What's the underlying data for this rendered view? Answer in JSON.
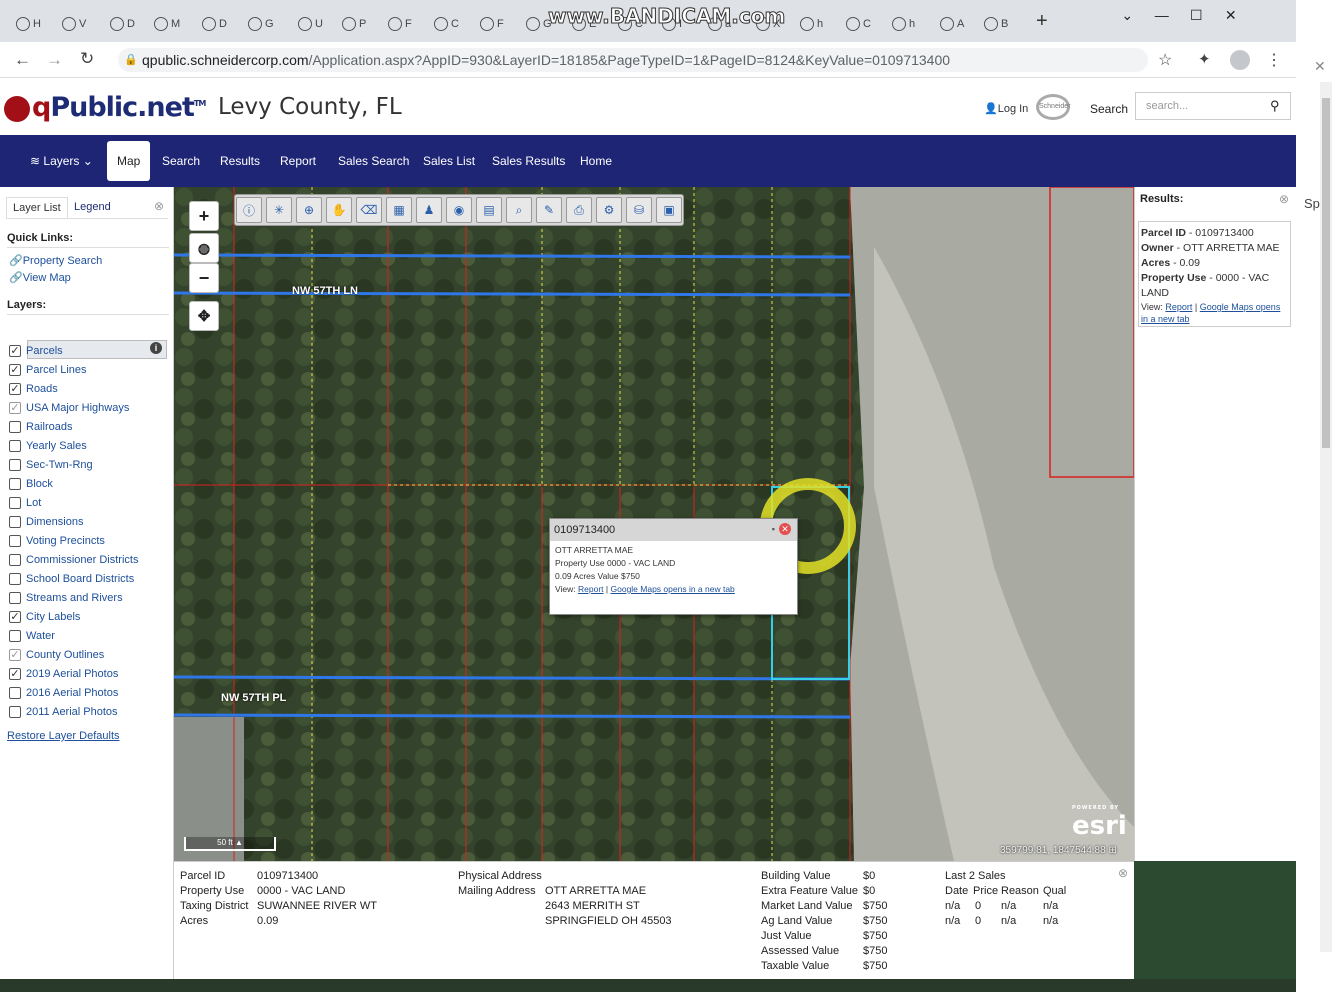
{
  "browser": {
    "tabs": [
      "H",
      "V",
      "D",
      "M",
      "D",
      "G",
      "U",
      "P",
      "F",
      "C",
      "F",
      "G",
      "E",
      "C",
      "I",
      "ä",
      "X",
      "h",
      "C",
      "h",
      "A",
      "B"
    ],
    "watermark": "www.BANDICAM.com",
    "url_main": "qpublic.schneidercorp.com",
    "url_rest": "/Application.aspx?AppID=930&LayerID=18185&PageTypeID=1&PageID=8124&KeyValue=0109713400",
    "new_tab": "+"
  },
  "header": {
    "logo_q": "q",
    "logo_rest": "Public.net",
    "logo_tm": "TM",
    "county": "Levy County, FL",
    "login": "Log In",
    "search_label": "Search",
    "search_placeholder": "search...",
    "schneider_logo_text": "Schneider"
  },
  "nav": {
    "items": [
      "Layers",
      "Map",
      "Search",
      "Results",
      "Report",
      "Sales Search",
      "Sales List",
      "Sales Results",
      "Home"
    ],
    "active": "Map"
  },
  "left_panel": {
    "tab_layer_list": "Layer List",
    "tab_legend": "Legend",
    "quick_links_title": "Quick Links:",
    "quick_links": [
      "Property Search",
      "View Map"
    ],
    "layers_title": "Layers:",
    "layers": [
      {
        "name": "Parcels",
        "checked": true,
        "grey": false
      },
      {
        "name": "Parcel Lines",
        "checked": true,
        "grey": false
      },
      {
        "name": "Roads",
        "checked": true,
        "grey": false
      },
      {
        "name": "USA Major Highways",
        "checked": true,
        "grey": true
      },
      {
        "name": "Railroads",
        "checked": false,
        "grey": false
      },
      {
        "name": "Yearly Sales",
        "checked": false,
        "grey": false
      },
      {
        "name": "Sec-Twn-Rng",
        "checked": false,
        "grey": false
      },
      {
        "name": "Block",
        "checked": false,
        "grey": false
      },
      {
        "name": "Lot",
        "checked": false,
        "grey": false
      },
      {
        "name": "Dimensions",
        "checked": false,
        "grey": false
      },
      {
        "name": "Voting Precincts",
        "checked": false,
        "grey": false
      },
      {
        "name": "Commissioner Districts",
        "checked": false,
        "grey": false
      },
      {
        "name": "School Board Districts",
        "checked": false,
        "grey": false
      },
      {
        "name": "Streams and Rivers",
        "checked": false,
        "grey": false
      },
      {
        "name": "City Labels",
        "checked": true,
        "grey": false
      },
      {
        "name": "Water",
        "checked": false,
        "grey": false
      },
      {
        "name": "County Outlines",
        "checked": true,
        "grey": true
      },
      {
        "name": "2019 Aerial Photos",
        "checked": true,
        "grey": false
      },
      {
        "name": "2016 Aerial Photos",
        "checked": false,
        "grey": false
      },
      {
        "name": "2011 Aerial Photos",
        "checked": false,
        "grey": false
      }
    ],
    "restore": "Restore Layer Defaults"
  },
  "map": {
    "road_labels": [
      "NW 57TH LN",
      "NW 57TH PL"
    ],
    "scale": "50 ft",
    "coords": "359799.81, 1847544.88",
    "esri": "esri",
    "esri_powered": "POWERED BY",
    "popup": {
      "title": "0109713400",
      "owner": "OTT ARRETTA MAE",
      "use": "Property Use 0000 - VAC LAND",
      "acres_value": "0.09 Acres  Value $750",
      "view_label": "View:",
      "report_link": "Report",
      "sep": "|",
      "gmaps_link": "Google Maps opens in a new tab"
    }
  },
  "results": {
    "title": "Results:",
    "parcel_label": "Parcel ID",
    "parcel": "0109713400",
    "owner_label": "Owner",
    "owner": "OTT ARRETTA MAE",
    "acres_label": "Acres",
    "acres": "0.09",
    "use_label": "Property Use",
    "use": "0000 - VAC LAND",
    "view_label": "View:",
    "report_link": "Report",
    "sep": "|",
    "gmaps_link": "Google Maps opens in a new tab"
  },
  "bottom": {
    "col1": [
      {
        "label": "Parcel ID",
        "value": "0109713400"
      },
      {
        "label": "Property Use",
        "value": "0000 - VAC LAND"
      },
      {
        "label": "Taxing District",
        "value": "SUWANNEE RIVER WT"
      },
      {
        "label": "Acres",
        "value": "0.09"
      }
    ],
    "physical_label": "Physical Address",
    "mailing_label": "Mailing Address",
    "mailing": [
      "OTT ARRETTA MAE",
      "2643 MERRITH ST",
      "SPRINGFIELD OH 45503"
    ],
    "values": [
      {
        "label": "Building Value",
        "value": "$0"
      },
      {
        "label": "Extra Feature Value",
        "value": "$0"
      },
      {
        "label": "Market Land Value",
        "value": "$750"
      },
      {
        "label": "Ag Land Value",
        "value": "$750"
      },
      {
        "label": "Just Value",
        "value": "$750"
      },
      {
        "label": "Assessed Value",
        "value": "$750"
      },
      {
        "label": "Taxable Value",
        "value": "$750"
      }
    ],
    "sales_title": "Last 2 Sales",
    "sales_headers": [
      "Date",
      "Price",
      "Reason",
      "Qual"
    ],
    "sales_rows": [
      [
        "n/a",
        "0",
        "n/a",
        "n/a"
      ],
      [
        "n/a",
        "0",
        "n/a",
        "n/a"
      ]
    ]
  },
  "right_edge": {
    "text": "Sp"
  },
  "colors": {
    "nav": "#1e2575",
    "logo_red": "#a30f17",
    "logo_blue": "#1d2c75",
    "link": "#1d4f9a",
    "ring": "#e3e026"
  }
}
